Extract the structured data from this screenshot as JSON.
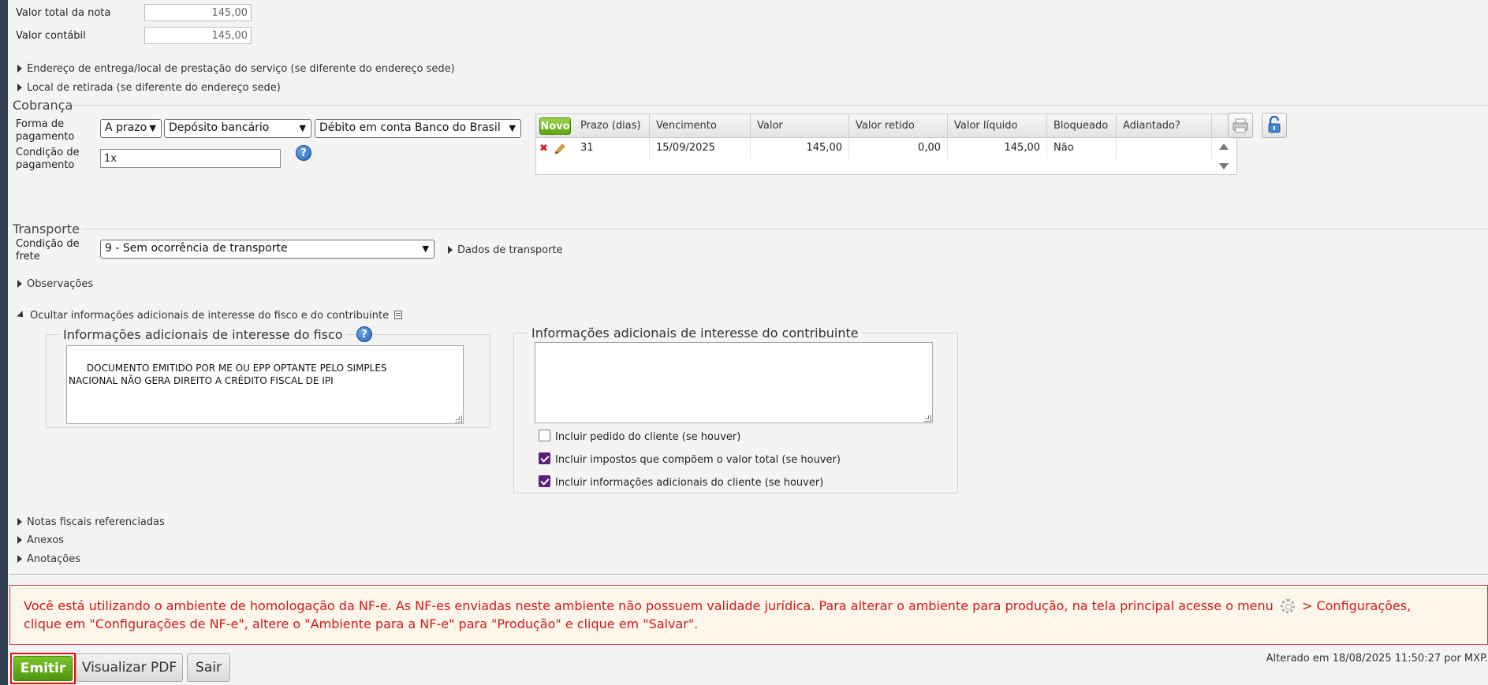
{
  "totals": {
    "valor_total_label": "Valor total da nota",
    "valor_total_value": "145,00",
    "valor_contabil_label": "Valor contábil",
    "valor_contabil_value": "145,00"
  },
  "expanders": {
    "endereco_entrega": "Endereço de entrega/local de prestação do serviço (se diferente do endereço sede)",
    "local_retirada": "Local de retirada (se diferente do endereço sede)",
    "dados_transporte": "Dados de transporte",
    "observacoes": "Observações",
    "ocultar_info": "Ocultar informações adicionais de interesse do fisco e do contribuinte",
    "notas_referenciadas": "Notas fiscais referenciadas",
    "anexos": "Anexos",
    "anotacoes": "Anotações"
  },
  "cobranca": {
    "title": "Cobrança",
    "forma_label_1": "Forma de",
    "forma_label_2": "pagamento",
    "forma_select_1": "A prazo",
    "forma_select_2": "Depósito bancário",
    "forma_select_3": "Débito em conta Banco do Brasil",
    "condicao_label_1": "Condição de",
    "condicao_label_2": "pagamento",
    "condicao_value": "1x",
    "help": "?"
  },
  "parcelas": {
    "novo_label": "Novo",
    "headers": [
      "Prazo (dias)",
      "Vencimento",
      "Valor",
      "Valor retido",
      "Valor líquido",
      "Bloqueado",
      "Adiantado?"
    ],
    "rows": [
      {
        "prazo": "31",
        "vencimento": "15/09/2025",
        "valor": "145,00",
        "retido": "0,00",
        "liquido": "145,00",
        "bloqueado": "Não",
        "adiantado": ""
      }
    ]
  },
  "transporte": {
    "title": "Transporte",
    "frete_label_1": "Condição de",
    "frete_label_2": "frete",
    "frete_value": "9 - Sem ocorrência de transporte"
  },
  "info_fisco": {
    "legend": "Informações adicionais de interesse do fisco",
    "text": "DOCUMENTO EMITIDO POR ME OU EPP OPTANTE PELO SIMPLES\nNACIONAL NÃO GERA DIREITO A CRÉDITO FISCAL DE IPI"
  },
  "info_contribuinte": {
    "legend": "Informações adicionais de interesse do contribuinte",
    "text": "",
    "checkboxes": [
      {
        "label": "Incluir pedido do cliente (se houver)",
        "checked": false
      },
      {
        "label": "Incluir impostos que compõem o valor total (se houver)",
        "checked": true
      },
      {
        "label": "Incluir informações adicionais do cliente (se houver)",
        "checked": true
      }
    ]
  },
  "alert": {
    "text_part1": "Você está utilizando o ambiente de homologação da NF-e. As NF-es enviadas neste ambiente não possuem validade jurídica. Para alterar o ambiente para produção, na tela principal acesse o menu",
    "text_part2": "> Configurações,",
    "text_line2": "clique em \"Configurações de NF-e\", altere o \"Ambiente para a NF-e\" para \"Produção\" e clique em \"Salvar\".",
    "color": "#d11a1a"
  },
  "footer": {
    "emitir": "Emitir",
    "visualizar_pdf": "Visualizar PDF",
    "sair": "Sair",
    "alterado": "Alterado em 18/08/2025 11:50:27 por MXP."
  },
  "colors": {
    "accent_green": "#5ea312",
    "checkbox_purple": "#5b1e7a",
    "alert_red": "#d83a3a"
  }
}
